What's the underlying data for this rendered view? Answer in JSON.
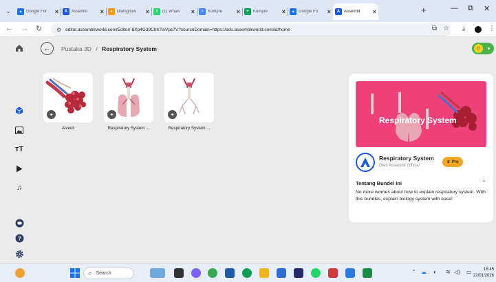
{
  "browser": {
    "tabs": [
      {
        "label": "Google For",
        "favicon_color": "#1a73e8",
        "favicon_glyph": "✦"
      },
      {
        "label": "Assembl",
        "favicon_color": "#1a5ad7",
        "favicon_glyph": "A"
      },
      {
        "label": "Dialogflow",
        "favicon_color": "#ff9800",
        "favicon_glyph": "●"
      },
      {
        "label": "(1) Whats",
        "favicon_color": "#25d366",
        "favicon_glyph": "1"
      },
      {
        "label": "Kompre",
        "favicon_color": "#4285f4",
        "favicon_glyph": "≡"
      },
      {
        "label": "Kompre",
        "favicon_color": "#0f9d58",
        "favicon_glyph": "+"
      },
      {
        "label": "Google Fo",
        "favicon_color": "#1a73e8",
        "favicon_glyph": "✦"
      },
      {
        "label": "Assembl",
        "favicon_color": "#1a5ad7",
        "favicon_glyph": "A",
        "active": true
      }
    ],
    "url": "editor.assemblrworld.com/Editor/-8Xp4G39Chtr7lnVpc7V?sourceDomain=https://edu.assemblrworld.com/id/home"
  },
  "breadcrumb": {
    "root": "Pustaka 3D",
    "separator": "/",
    "current": "Respiratory System"
  },
  "items": [
    {
      "name": "Alveoli",
      "icon": "alveoli-model"
    },
    {
      "name": "Respiratory System ...",
      "icon": "respiratory-model"
    },
    {
      "name": "Respiratory System ...",
      "icon": "respiratory-model-outline"
    }
  ],
  "bundle": {
    "banner_title": "Respiratory System",
    "title": "Respiratory System",
    "owner": "Oleh Assemblr Official",
    "pro_label": "Pro",
    "about_heading": "Tentang Bundel Ini",
    "description": "No more worries about how to explain respiratory system. With this bundles, explain biology system with ease!",
    "banner_color": "#f0407a"
  },
  "taskbar": {
    "search_label": "Search",
    "time": "16:45",
    "date": "22/01/2026"
  }
}
